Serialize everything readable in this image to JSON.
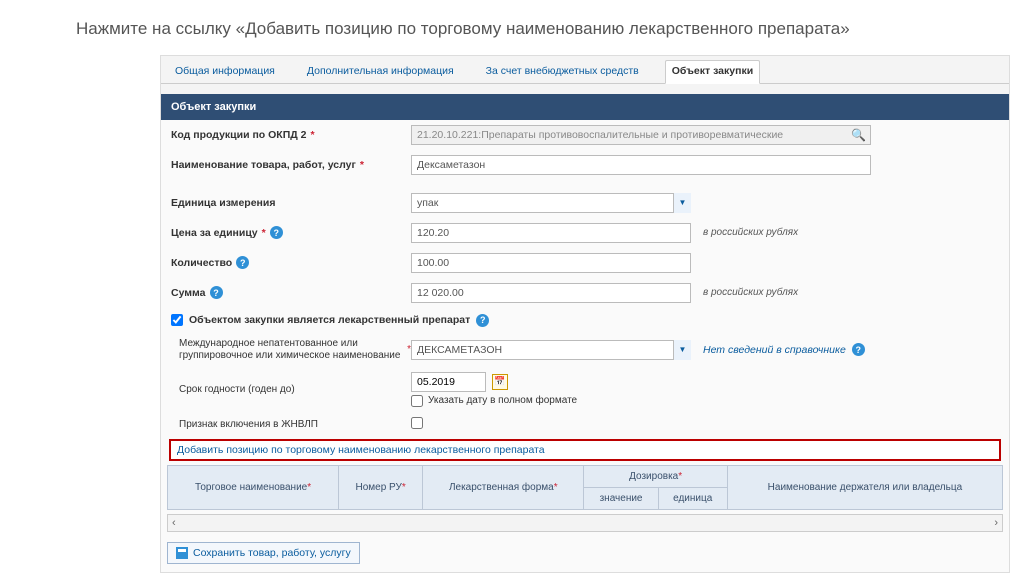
{
  "instruction": "Нажмите на ссылку «Добавить позицию по торговому наименованию лекарственного препарата»",
  "tabs": {
    "general": "Общая информация",
    "additional": "Дополнительная информация",
    "offbudget": "За счет внебюджетных средств",
    "object": "Объект закупки"
  },
  "section_title": "Объект закупки",
  "labels": {
    "okpd": "Код продукции по ОКПД 2",
    "name": "Наименование товара, работ, услуг",
    "unit": "Единица измерения",
    "price": "Цена за единицу",
    "qty": "Количество",
    "sum": "Сумма",
    "is_drug": "Объектом закупки является лекарственный препарат",
    "mnn": "Международное непатентованное или группировочное или химическое наименование",
    "expiry": "Срок годности (годен до)",
    "full_date": "Указать дату в полном формате",
    "zhnvlp": "Признак включения в ЖНВЛП",
    "no_ref": "Нет сведений в справочнике",
    "add_link": "Добавить позицию по торговому наименованию лекарственного препарата"
  },
  "values": {
    "okpd": "21.20.10.221:Препараты противовоспалительные и противоревматические",
    "name": "Дексаметазон",
    "unit": "упак",
    "price": "120.20",
    "qty": "100.00",
    "sum": "12 020.00",
    "mnn": "ДЕКСАМЕТАЗОН",
    "expiry": "05.2019"
  },
  "hints": {
    "rub": "в российских рублях"
  },
  "table": {
    "trade_name": "Торговое наименование",
    "reg_num": "Номер РУ",
    "form": "Лекарственная форма",
    "dosage": "Дозировка",
    "dosage_value": "значение",
    "dosage_unit": "единица",
    "holder": "Наименование держателя или владельца"
  },
  "save_btn": "Сохранить товар, работу, услугу"
}
